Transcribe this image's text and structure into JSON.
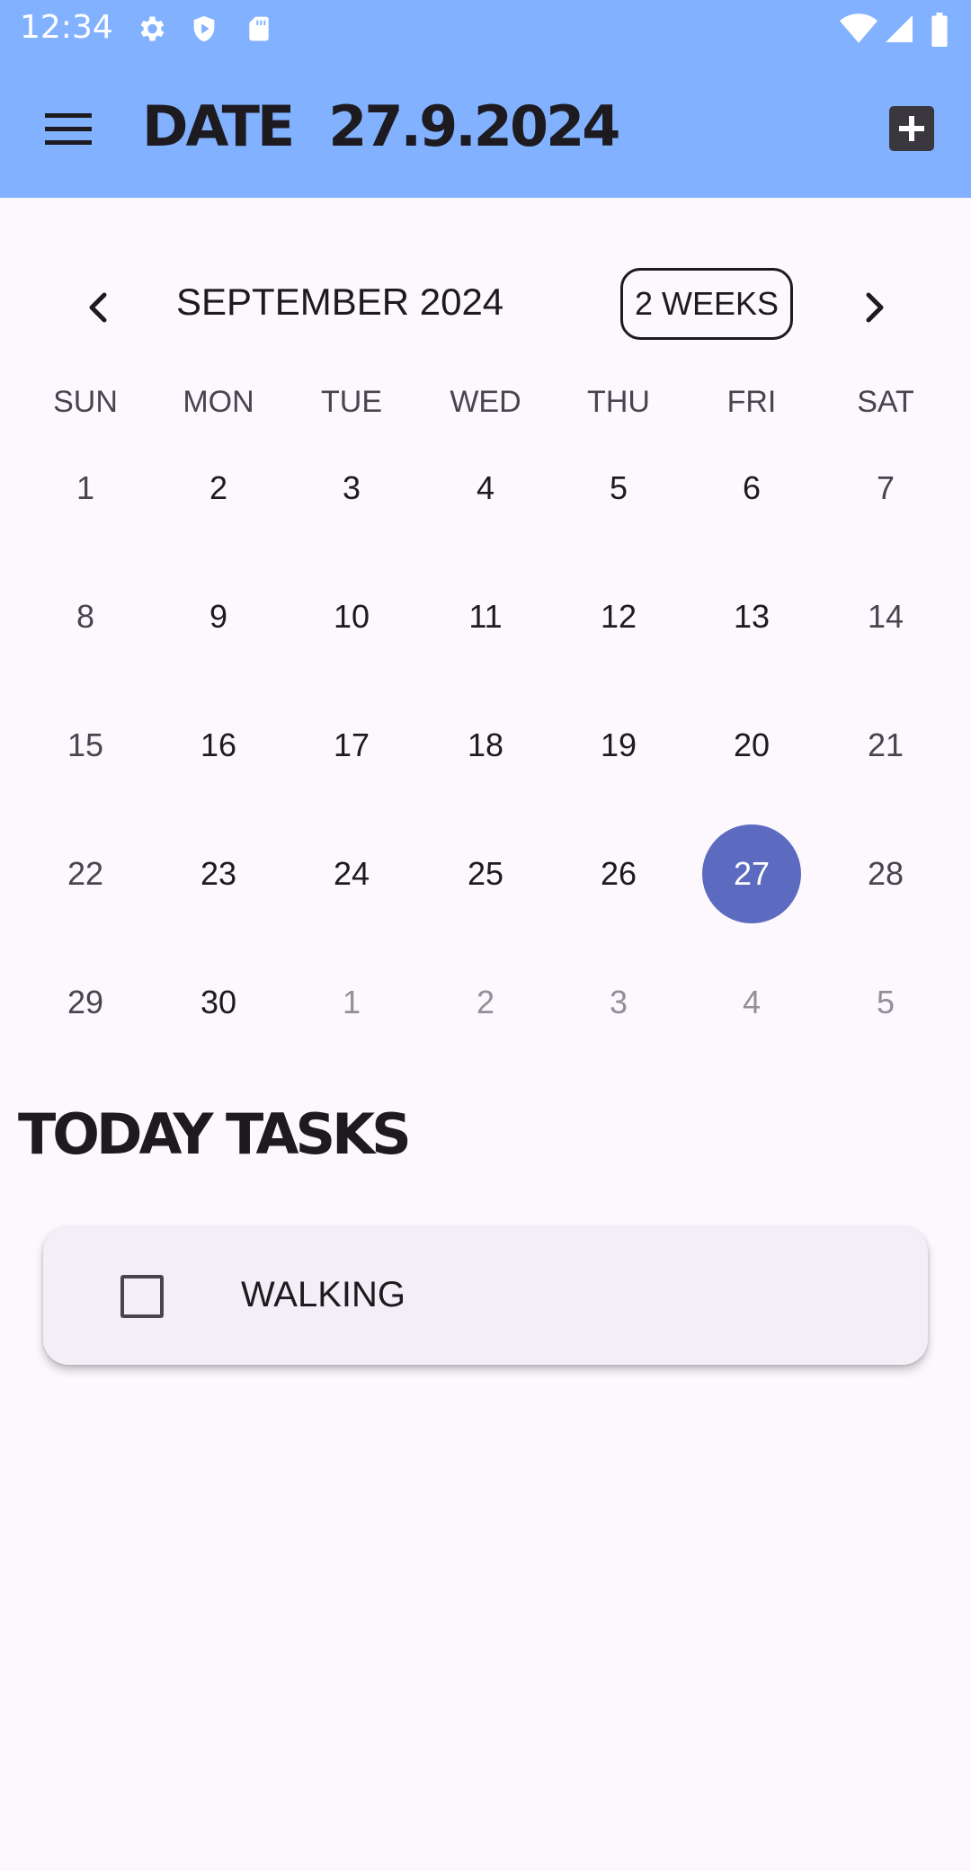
{
  "status_bar": {
    "time": "12:34",
    "icons": [
      "gear-icon",
      "shield-play-icon",
      "sd-card-icon",
      "wifi-icon",
      "signal-icon",
      "battery-icon"
    ]
  },
  "app_bar": {
    "title_prefix": "DATE",
    "title_date": "27.9.2024",
    "menu_icon": "menu-icon",
    "add_icon": "add-box-icon",
    "background_color": "#82b1ff"
  },
  "calendar": {
    "month_label": "SEPTEMBER 2024",
    "format_button": "2 WEEKS",
    "weekdays": [
      "SUN",
      "MON",
      "TUE",
      "WED",
      "THU",
      "FRI",
      "SAT"
    ],
    "weeks": [
      [
        "1",
        "2",
        "3",
        "4",
        "5",
        "6",
        "7"
      ],
      [
        "8",
        "9",
        "10",
        "11",
        "12",
        "13",
        "14"
      ],
      [
        "15",
        "16",
        "17",
        "18",
        "19",
        "20",
        "21"
      ],
      [
        "22",
        "23",
        "24",
        "25",
        "26",
        "27",
        "28"
      ],
      [
        "29",
        "30",
        "1",
        "2",
        "3",
        "4",
        "5"
      ]
    ],
    "selected_day": "27",
    "selected_color": "#5c6bc0"
  },
  "tasks": {
    "section_title": "TODAY TASKS",
    "items": [
      {
        "label": "WALKING",
        "checked": false
      }
    ]
  }
}
